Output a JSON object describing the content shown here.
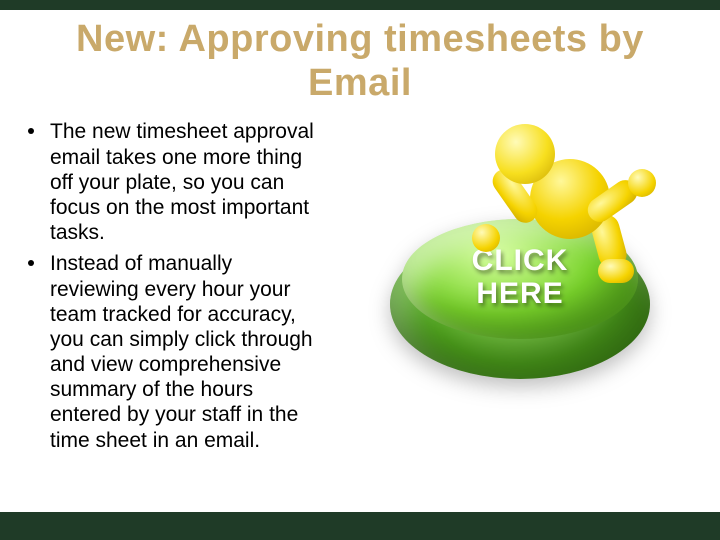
{
  "title": "New:  Approving timesheets  by Email",
  "bullets": [
    "The new timesheet approval email takes one more thing off your plate, so you can focus on the most important tasks.",
    " Instead of manually reviewing every hour your team tracked for accuracy, you can simply click through and view comprehensive summary of the hours entered by your staff in the time sheet in an email."
  ],
  "button": {
    "line1": "CLICK",
    "line2": "HERE"
  }
}
